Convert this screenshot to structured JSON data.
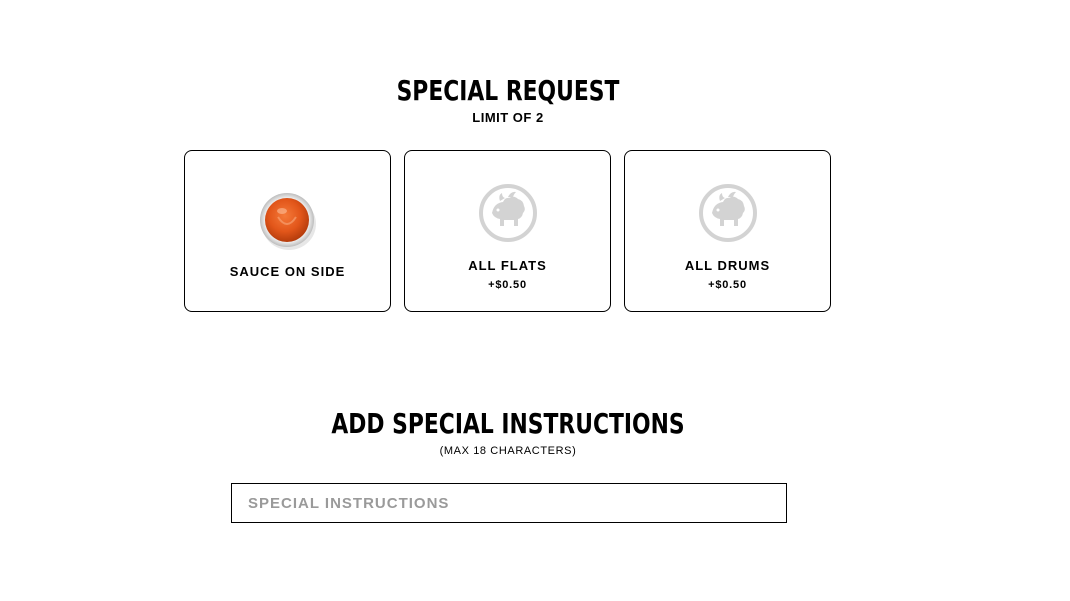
{
  "special_request": {
    "title": "SPECIAL REQUEST",
    "subtitle": "LIMIT OF 2",
    "options": [
      {
        "label": "SAUCE ON SIDE",
        "price": "",
        "icon": "sauce-cup-icon"
      },
      {
        "label": "ALL FLATS",
        "price": "+$0.50",
        "icon": "buffalo-logo-icon"
      },
      {
        "label": "ALL DRUMS",
        "price": "+$0.50",
        "icon": "buffalo-logo-icon"
      }
    ]
  },
  "special_instructions": {
    "title": "ADD SPECIAL INSTRUCTIONS",
    "subtitle": "(MAX 18 CHARACTERS)",
    "placeholder": "SPECIAL INSTRUCTIONS",
    "value": ""
  },
  "colors": {
    "sauce": "#e2561a",
    "logo_gray": "#d3d3d3",
    "border": "#000000",
    "placeholder": "#9a9a9a"
  }
}
